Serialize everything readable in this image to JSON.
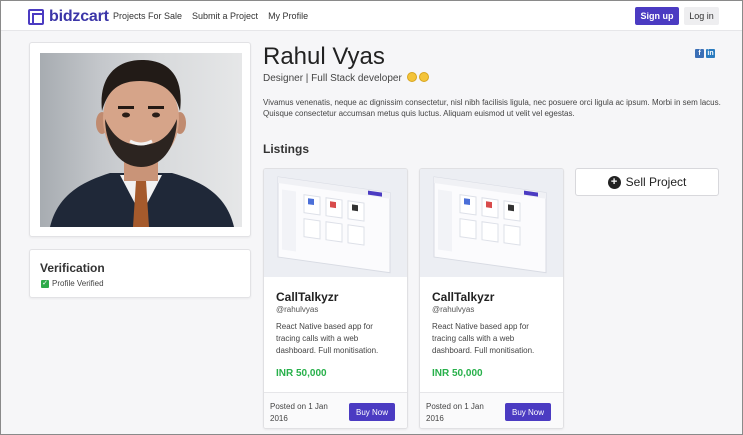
{
  "nav": {
    "brand": "bidzcart",
    "links": [
      "Projects For Sale",
      "Submit a Project",
      "My Profile"
    ],
    "signup_label": "Sign up",
    "login_label": "Log in"
  },
  "profile": {
    "name": "Rahul Vyas",
    "role": "Designer | Full Stack developer",
    "bio": "Vivamus venenatis, neque ac dignissim consectetur, nisl nibh facilisis ligula, nec posuere orci ligula ac ipsum. Morbi in sem lacus. Quisque consectetur accumsan metus quis luctus. Aliquam euismod ut velit vel egestas."
  },
  "verification": {
    "title": "Verification",
    "status": "Profile Verified"
  },
  "listings": {
    "title": "Listings",
    "items": [
      {
        "title": "CallTalkyzr",
        "user": "@rahulvyas",
        "description": "React Native based app for tracing calls with a web dashboard. Full monitisation.",
        "price": "INR 50,000",
        "posted": "Posted on 1 Jan 2016",
        "buy_label": "Buy Now"
      },
      {
        "title": "CallTalkyzr",
        "user": "@rahulvyas",
        "description": "React Native based app for tracing calls with a web dashboard. Full monitisation.",
        "price": "INR 50,000",
        "posted": "Posted on 1 Jan 2016",
        "buy_label": "Buy Now"
      }
    ],
    "sell_label": "Sell Project"
  },
  "colors": {
    "brand": "#4b3bc2",
    "price": "#27b04a",
    "verified": "#2eaa4a"
  },
  "icons": {
    "facebook": "facebook-icon",
    "linkedin": "linkedin-icon",
    "sell": "plus-circle-icon",
    "verified": "checkbox-checked-icon"
  }
}
